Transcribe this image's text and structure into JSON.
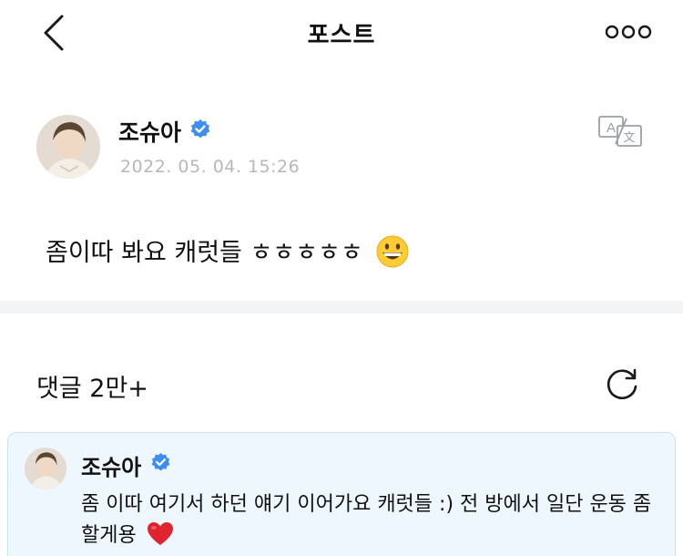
{
  "header": {
    "title": "포스트",
    "back_icon": "chevron-left-icon",
    "more_icon": "more-horizontal-icon"
  },
  "post": {
    "author": "조슈아",
    "verified": true,
    "date": "2022. 05. 04. 15:26",
    "text": "좀이따 봐요 캐럿들 ㅎㅎㅎㅎㅎ",
    "emoji": "grinning-face-emoji",
    "translate_icon": "translate-icon"
  },
  "comments": {
    "count_label": "댓글 2만+",
    "refresh_icon": "refresh-icon"
  },
  "pinned_comment": {
    "author": "조슈아",
    "verified": true,
    "text": "좀 이따 여기서 하던 얘기 이어가요 캐럿들 :) 전 방에서 일단 운동 좀 할게용",
    "emoji": "red-heart-emoji"
  },
  "colors": {
    "verified_blue": "#3d8ef0",
    "date_gray": "#b4b8bd",
    "divider": "#f3f4f6",
    "pinned_bg": "#eef7fd",
    "pinned_border": "#c5e3f6"
  }
}
